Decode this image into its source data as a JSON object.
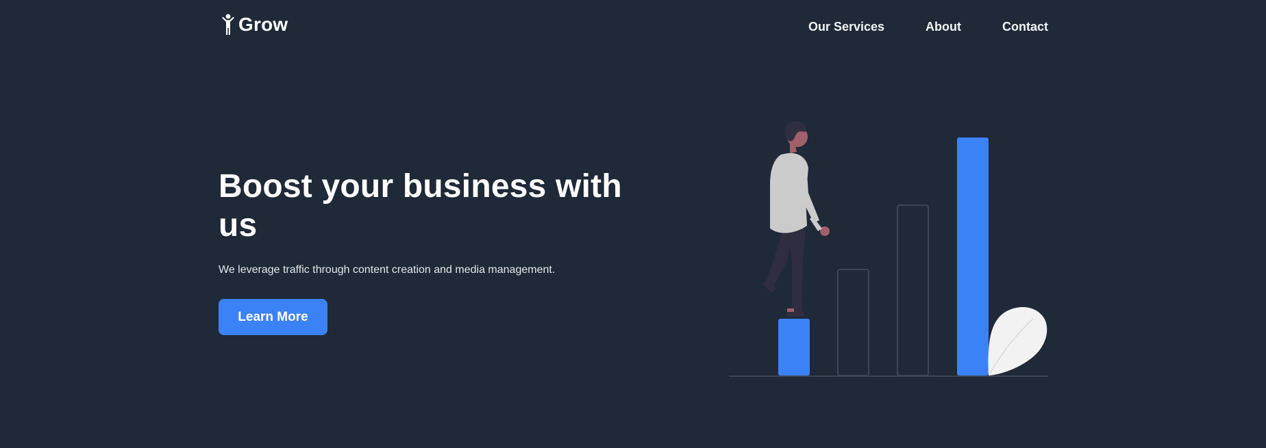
{
  "header": {
    "logo_text": "Grow",
    "logo_icon": "person-arms-raised-icon",
    "nav": [
      {
        "label": "Our Services"
      },
      {
        "label": "About"
      },
      {
        "label": "Contact"
      }
    ]
  },
  "hero": {
    "title": "Boost your business with us",
    "subtitle": "We leverage traffic through content creation and media management.",
    "cta_label": "Learn More"
  },
  "illustration": {
    "name": "growth-bars-illustration"
  },
  "colors": {
    "background": "#1f2937",
    "accent": "#3b82f6",
    "text": "#ffffff",
    "bar_outline": "#3f4654",
    "leaf": "#f2f2f2",
    "figure_shirt": "#cbcbcb",
    "figure_pants": "#2f2e41",
    "figure_skin": "#a0616a"
  }
}
